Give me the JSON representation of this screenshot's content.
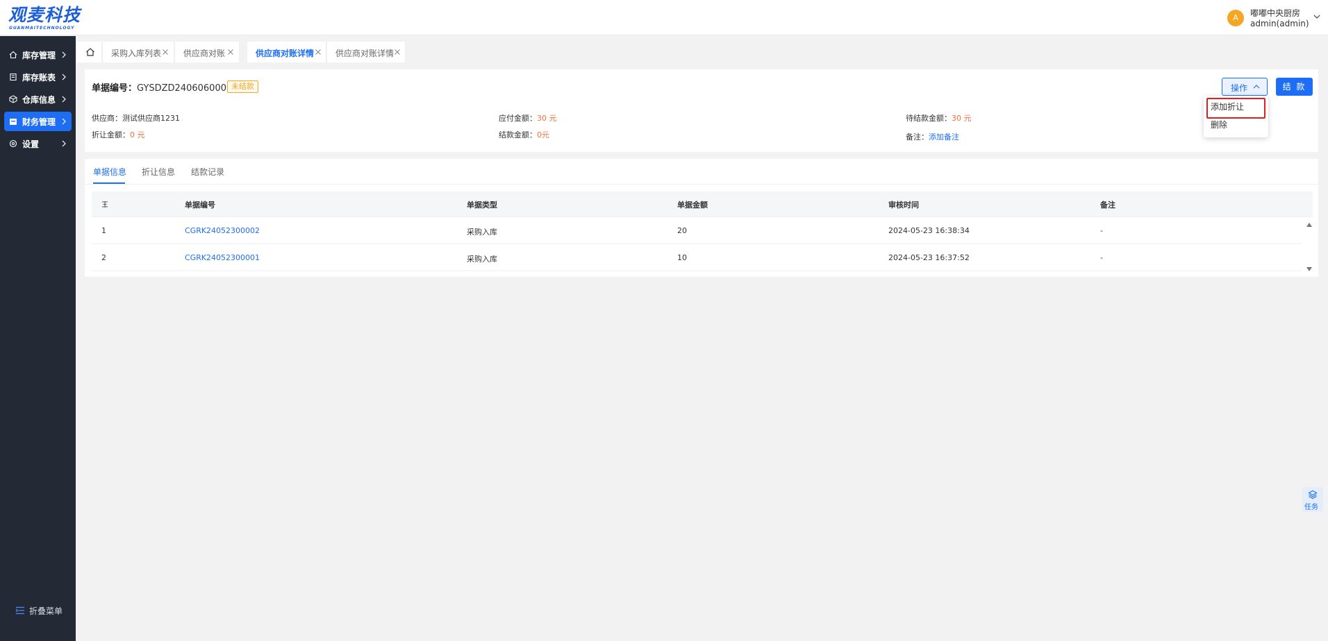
{
  "brand": {
    "name": "观麦科技",
    "tagline": "GUANMAITECHNOLOGY",
    "accent": "#1e6ef5"
  },
  "user": {
    "avatar_letter": "A",
    "org": "嘟嘟中央厨房",
    "name": "admin(admin)"
  },
  "sidebar": {
    "items": [
      {
        "label": "库存管理",
        "icon": "home-icon",
        "active": false
      },
      {
        "label": "库存账表",
        "icon": "book-icon",
        "active": false
      },
      {
        "label": "仓库信息",
        "icon": "cube-icon",
        "active": false
      },
      {
        "label": "财务管理",
        "icon": "wallet-icon",
        "active": true
      },
      {
        "label": "设置",
        "icon": "gear-icon",
        "active": false
      }
    ],
    "collapse_label": "折叠菜单"
  },
  "tabs": [
    {
      "label": "采购入库列表",
      "active": false
    },
    {
      "label": "供应商对账",
      "active": false
    },
    {
      "label": "供应商对账详情",
      "active": true
    },
    {
      "label": "供应商对账详情",
      "active": false
    }
  ],
  "header": {
    "doc_label": "单据编号：",
    "doc_number": "GYSDZD24060600008",
    "status": "未结款",
    "ops_label": "操作",
    "settle_label": "结 款",
    "fields": {
      "supplier_label": "供应商：",
      "supplier_value": "测试供应商1231",
      "payable_label": "应付金额：",
      "payable_value": "30 元",
      "pending_label": "待结款金额：",
      "pending_value": "30 元",
      "discount_label": "折让金额：",
      "discount_value": "0 元",
      "settled_label": "结款金额：",
      "settled_value": "0元",
      "remark_label": "备注：",
      "remark_link": "添加备注"
    }
  },
  "dropdown": {
    "items": [
      "添加折让",
      "删除"
    ],
    "highlighted": "添加折让"
  },
  "detail_tabs": [
    {
      "label": "单据信息",
      "active": true
    },
    {
      "label": "折让信息",
      "active": false
    },
    {
      "label": "结款记录",
      "active": false
    }
  ],
  "table": {
    "columns": [
      "单据编号",
      "单据类型",
      "单据金额",
      "审核时间",
      "备注"
    ],
    "rows": [
      {
        "index": "1",
        "doc_no": "CGRK24052300002",
        "type": "采购入库",
        "amount": "20",
        "time": "2024-05-23 16:38:34",
        "remark": "-"
      },
      {
        "index": "2",
        "doc_no": "CGRK24052300001",
        "type": "采购入库",
        "amount": "10",
        "time": "2024-05-23 16:37:52",
        "remark": "-"
      }
    ]
  },
  "task_float": {
    "label": "任务"
  }
}
